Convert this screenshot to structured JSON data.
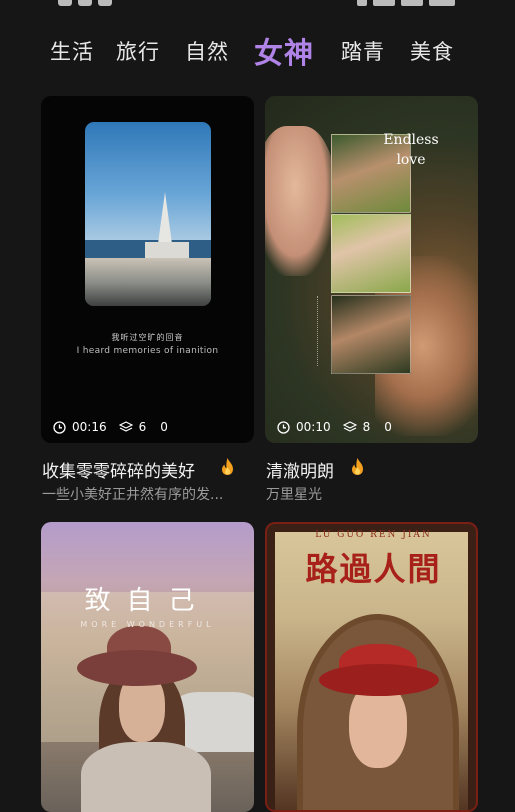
{
  "tabs": [
    {
      "label": "生活"
    },
    {
      "label": "旅行"
    },
    {
      "label": "自然"
    },
    {
      "label": "女神",
      "active": true
    },
    {
      "label": "踏青"
    },
    {
      "label": "美食"
    }
  ],
  "active_tab_color": "#b083e6",
  "cards": [
    {
      "title": "收集零零碎碎的美好",
      "subtitle": "一些小美好正井然有序的发...",
      "duration": "00:16",
      "layers": "6",
      "count": "0",
      "hot": true,
      "overlay_cn": "我听过空旷的回音",
      "overlay_en": "I heard memories of inanition"
    },
    {
      "title": "清澈明朗",
      "subtitle": "万里星光",
      "duration": "00:10",
      "layers": "8",
      "count": "0",
      "hot": true,
      "overlay_line1": "Endless",
      "overlay_line2": "love"
    },
    {
      "title_overlay": "致自己",
      "subtitle_overlay": "MORE WONDERFUL"
    },
    {
      "pinyin_overlay": "LU  GUO  REN  JIAN",
      "title_overlay": "路過人間"
    }
  ],
  "icons": {
    "clock": "clock-icon",
    "layers": "layers-icon",
    "fire": "fire-icon"
  }
}
